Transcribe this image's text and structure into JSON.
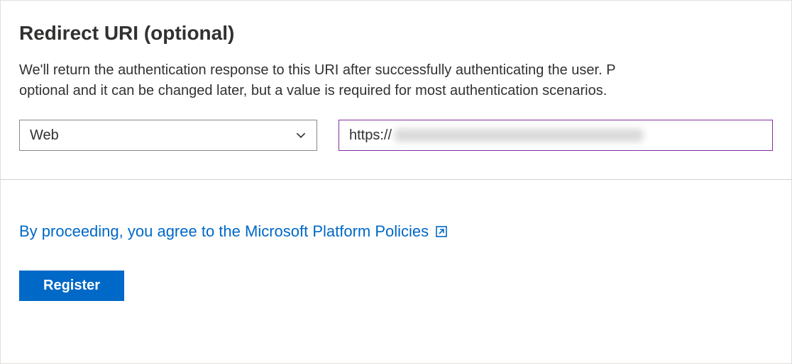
{
  "section": {
    "heading": "Redirect URI (optional)",
    "description_line1": "We'll return the authentication response to this URI after successfully authenticating the user. P",
    "description_line2": "optional and it can be changed later, but a value is required for most authentication scenarios."
  },
  "platform_select": {
    "selected": "Web"
  },
  "uri_input": {
    "prefix": "https://"
  },
  "policy": {
    "text": "By proceeding, you agree to the Microsoft Platform Policies"
  },
  "actions": {
    "register": "Register"
  },
  "colors": {
    "primary": "#0068c6",
    "input_focus_border": "#832da3"
  }
}
